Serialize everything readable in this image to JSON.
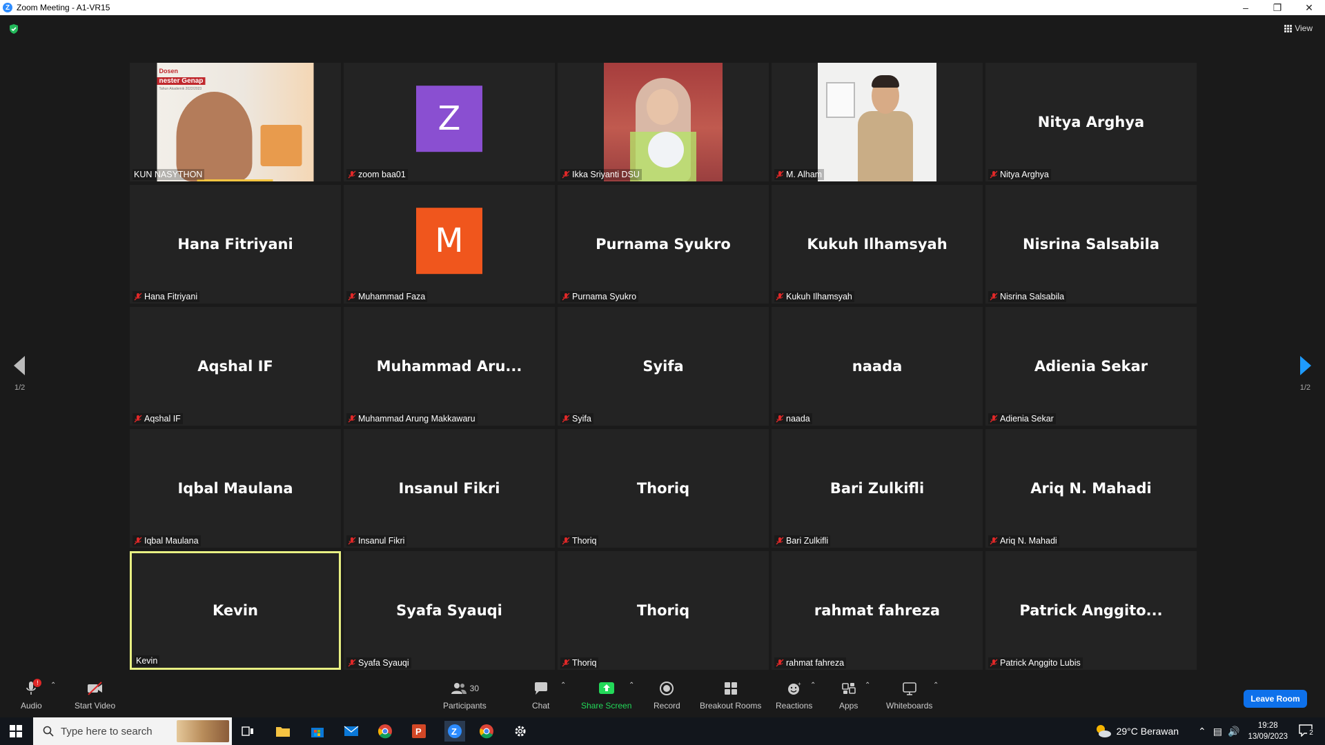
{
  "window": {
    "title": "Zoom Meeting - A1-VR15",
    "view_label": "View"
  },
  "pagination": {
    "left": "1/2",
    "right": "1/2"
  },
  "participants": [
    {
      "display": "",
      "label": "KUN NASYTHON",
      "muted": false,
      "kind": "video",
      "active": false
    },
    {
      "display": "Z",
      "label": "zoom baa01",
      "muted": true,
      "kind": "avatar",
      "color": "#8a4fd1",
      "active": false
    },
    {
      "display": "",
      "label": "Ikka Sriyanti DSU",
      "muted": true,
      "kind": "video",
      "active": false
    },
    {
      "display": "",
      "label": "M. Alham",
      "muted": true,
      "kind": "video",
      "active": false
    },
    {
      "display": "Nitya Arghya",
      "label": "Nitya Arghya",
      "muted": true,
      "kind": "name",
      "active": false
    },
    {
      "display": "Hana Fitriyani",
      "label": "Hana Fitriyani",
      "muted": true,
      "kind": "name",
      "active": false
    },
    {
      "display": "M",
      "label": "Muhammad Faza",
      "muted": true,
      "kind": "avatar",
      "color": "#f0561d",
      "active": false
    },
    {
      "display": "Purnama Syukro",
      "label": "Purnama Syukro",
      "muted": true,
      "kind": "name",
      "active": false
    },
    {
      "display": "Kukuh Ilhamsyah",
      "label": "Kukuh Ilhamsyah",
      "muted": true,
      "kind": "name",
      "active": false
    },
    {
      "display": "Nisrina Salsabila",
      "label": "Nisrina Salsabila",
      "muted": true,
      "kind": "name",
      "active": false
    },
    {
      "display": "Aqshal IF",
      "label": "Aqshal IF",
      "muted": true,
      "kind": "name",
      "active": false
    },
    {
      "display": "Muhammad  Aru...",
      "label": "Muhammad Arung Makkawaru",
      "muted": true,
      "kind": "name",
      "active": false
    },
    {
      "display": "Syifa",
      "label": "Syifa",
      "muted": true,
      "kind": "name",
      "active": false
    },
    {
      "display": "naada",
      "label": "naada",
      "muted": true,
      "kind": "name",
      "active": false
    },
    {
      "display": "Adienia Sekar",
      "label": "Adienia Sekar",
      "muted": true,
      "kind": "name",
      "active": false
    },
    {
      "display": "Iqbal Maulana",
      "label": "Iqbal Maulana",
      "muted": true,
      "kind": "name",
      "active": false
    },
    {
      "display": "Insanul Fikri",
      "label": "Insanul Fikri",
      "muted": true,
      "kind": "name",
      "active": false
    },
    {
      "display": "Thoriq",
      "label": "Thoriq",
      "muted": true,
      "kind": "name",
      "active": false
    },
    {
      "display": "Bari Zulkifli",
      "label": "Bari Zulkifli",
      "muted": true,
      "kind": "name",
      "active": false
    },
    {
      "display": "Ariq N. Mahadi",
      "label": "Ariq N. Mahadi",
      "muted": true,
      "kind": "name",
      "active": false
    },
    {
      "display": "Kevin",
      "label": "Kevin",
      "muted": false,
      "kind": "name",
      "active": true
    },
    {
      "display": "Syafa Syauqi",
      "label": "Syafa Syauqi",
      "muted": true,
      "kind": "name",
      "active": false
    },
    {
      "display": "Thoriq",
      "label": "Thoriq",
      "muted": true,
      "kind": "name",
      "active": false
    },
    {
      "display": "rahmat fahreza",
      "label": "rahmat fahreza",
      "muted": true,
      "kind": "name",
      "active": false
    },
    {
      "display": "Patrick  Anggito...",
      "label": "Patrick Anggito Lubis",
      "muted": true,
      "kind": "name",
      "active": false
    }
  ],
  "slide_text": {
    "line1": "Dosen",
    "line2": "nester Genap",
    "line3": "Tahun Akademik 2022/2023"
  },
  "toolbar": {
    "audio": "Audio",
    "start_video": "Start Video",
    "participants": "Participants",
    "participants_count": "30",
    "chat": "Chat",
    "share_screen": "Share Screen",
    "record": "Record",
    "breakout_rooms": "Breakout Rooms",
    "reactions": "Reactions",
    "apps": "Apps",
    "whiteboards": "Whiteboards",
    "leave": "Leave Room",
    "audio_badge": "!"
  },
  "taskbar": {
    "search_placeholder": "Type here to search",
    "weather": "29°C  Berawan",
    "time": "19:28",
    "date": "13/09/2023",
    "notifications": "2"
  },
  "colors": {
    "accent": "#0e71eb",
    "share_green": "#23d959",
    "active_border": "#e8f083"
  }
}
